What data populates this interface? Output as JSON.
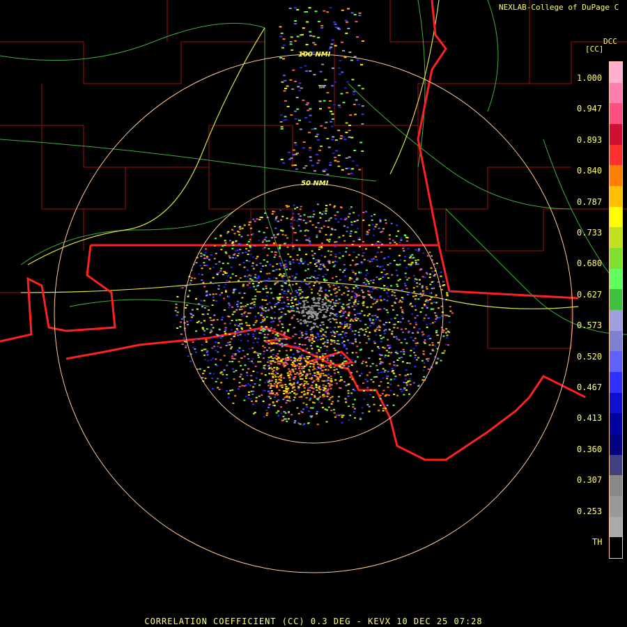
{
  "header": {
    "credit": "NEXLAB-College of DuPage C",
    "site_tag": "DCC",
    "unit": "[CC]"
  },
  "rings": [
    {
      "label": "100 NMI"
    },
    {
      "label": "50 NMI"
    }
  ],
  "colorbar": {
    "labels": [
      "1.000",
      "0.947",
      "0.893",
      "0.840",
      "0.787",
      "0.733",
      "0.680",
      "0.627",
      "0.573",
      "0.520",
      "0.467",
      "0.413",
      "0.360",
      "0.307",
      "0.253",
      "TH"
    ],
    "colors": [
      "#ffb0d0",
      "#ff80b0",
      "#ff5080",
      "#d01030",
      "#ff3030",
      "#ff8000",
      "#ffc000",
      "#ffff00",
      "#c0e020",
      "#80e030",
      "#60ff60",
      "#40c040",
      "#a0a0e0",
      "#8080d0",
      "#6060ff",
      "#3030ff",
      "#1010d0",
      "#0000a0",
      "#000080",
      "#404080",
      "#888888",
      "#999999",
      "#aaaaaa",
      "#000000"
    ]
  },
  "footer": "CORRELATION COEFFICIENT (CC) 0.3 DEG - KEVX 10 DEC 25 07:28",
  "colors": {
    "text": "#ffff66",
    "state_border": "#ff2020",
    "county_border": "#b01010",
    "highway": "#40c040",
    "interstate": "#e0e040",
    "range_ring": "#ffcc99"
  }
}
